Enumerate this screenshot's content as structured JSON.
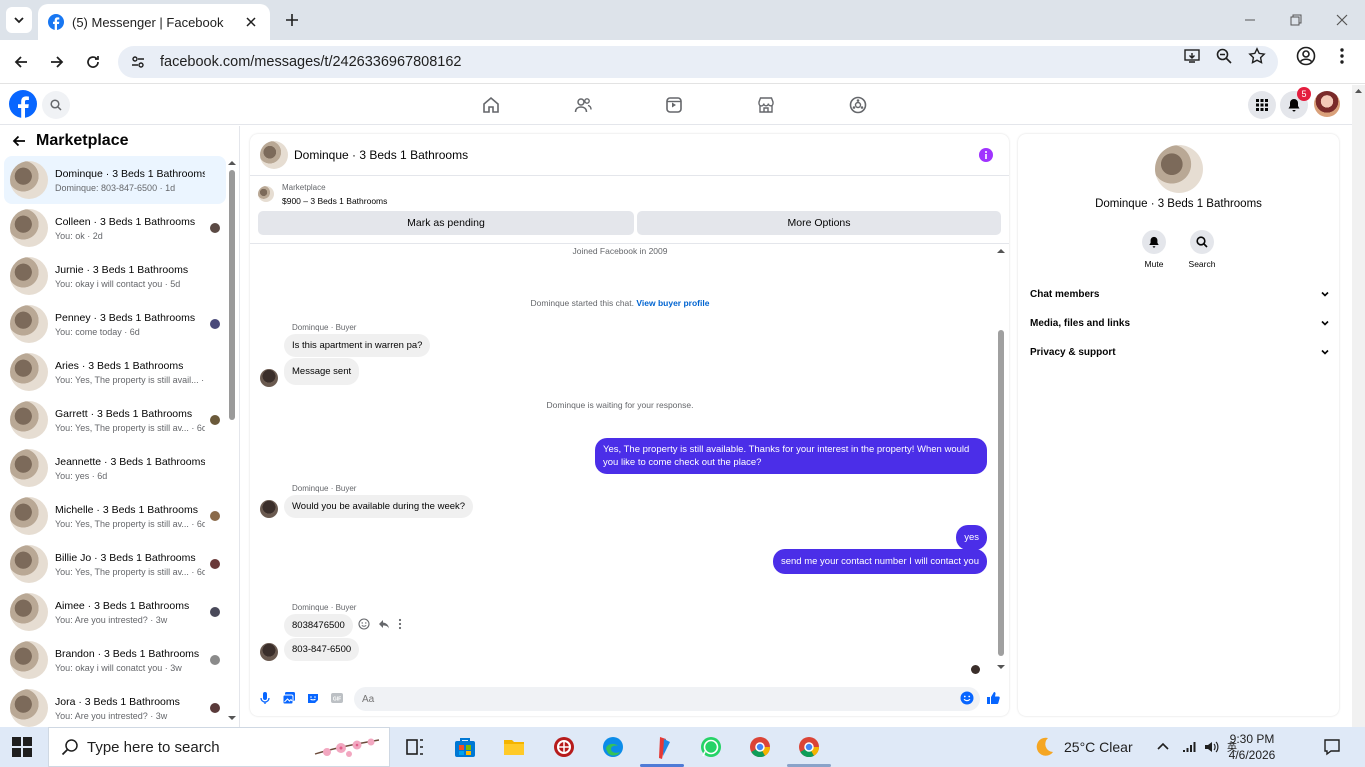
{
  "browser": {
    "tab_title": "(5) Messenger | Facebook",
    "url": "facebook.com/messages/t/2426336967808162"
  },
  "fb": {
    "notification_count": "5",
    "accent": "#1877f2"
  },
  "sidebar": {
    "title": "Marketplace",
    "conversations": [
      {
        "name": "Dominque · 3 Beds 1 Bathrooms",
        "preview": "Dominque: 803-847-6500 · 1d",
        "active": true
      },
      {
        "name": "Colleen · 3 Beds 1 Bathrooms",
        "preview": "You: ok · 2d"
      },
      {
        "name": "Jurnie · 3 Beds 1 Bathrooms",
        "preview": "You: okay i will contact you · 5d"
      },
      {
        "name": "Penney · 3 Beds 1 Bathrooms",
        "preview": "You: come today · 6d"
      },
      {
        "name": "Aries · 3 Beds 1 Bathrooms",
        "preview": "You: Yes, The property is still avail... · 6d"
      },
      {
        "name": "Garrett · 3 Beds 1 Bathrooms",
        "preview": "You: Yes, The property is still av... · 6d"
      },
      {
        "name": "Jeannette · 3 Beds 1 Bathrooms",
        "preview": "You: yes · 6d"
      },
      {
        "name": "Michelle · 3 Beds 1 Bathrooms",
        "preview": "You: Yes, The property is still av... · 6d"
      },
      {
        "name": "Billie Jo · 3 Beds 1 Bathrooms",
        "preview": "You: Yes, The property is still av... · 6d"
      },
      {
        "name": "Aimee · 3 Beds 1 Bathrooms",
        "preview": "You: Are you intrested? · 3w"
      },
      {
        "name": "Brandon · 3 Beds 1 Bathrooms",
        "preview": "You: okay i will conatct you · 3w"
      },
      {
        "name": "Jora · 3 Beds 1 Bathrooms",
        "preview": "You: Are you intrested? · 3w"
      }
    ]
  },
  "chat": {
    "title": "Dominque · 3 Beds 1 Bathrooms",
    "listing_label": "Marketplace",
    "listing_title": "$900 – 3 Beds 1 Bathrooms",
    "mark_pending": "Mark as pending",
    "more_options": "More Options",
    "joined": "Joined Facebook in 2009",
    "started": "Dominque started this chat.",
    "view_profile": "View buyer profile",
    "sender_label": "Dominque · Buyer",
    "msg1": "Is this apartment in warren pa?",
    "msg2": "Message sent",
    "waiting": "Dominque is waiting for your response.",
    "out1": "Yes, The property is still available. Thanks for your interest in the property! When would you like to come check out the place?",
    "msg3": "Would you be available during the week?",
    "out2": "yes",
    "out3": "send me your contact number I will contact you",
    "msg4": "8038476500",
    "msg5": "803-847-6500",
    "composer_placeholder": "Aa",
    "outgoing_color": "#4b2ee8"
  },
  "rpanel": {
    "name": "Dominque · 3 Beds 1 Bathrooms",
    "mute": "Mute",
    "search": "Search",
    "rows": [
      "Chat members",
      "Media, files and links",
      "Privacy & support"
    ]
  },
  "taskbar": {
    "search_placeholder": "Type here to search",
    "weather": "25°C  Clear",
    "time": "9:30 PM",
    "date": "4/6/2026"
  }
}
